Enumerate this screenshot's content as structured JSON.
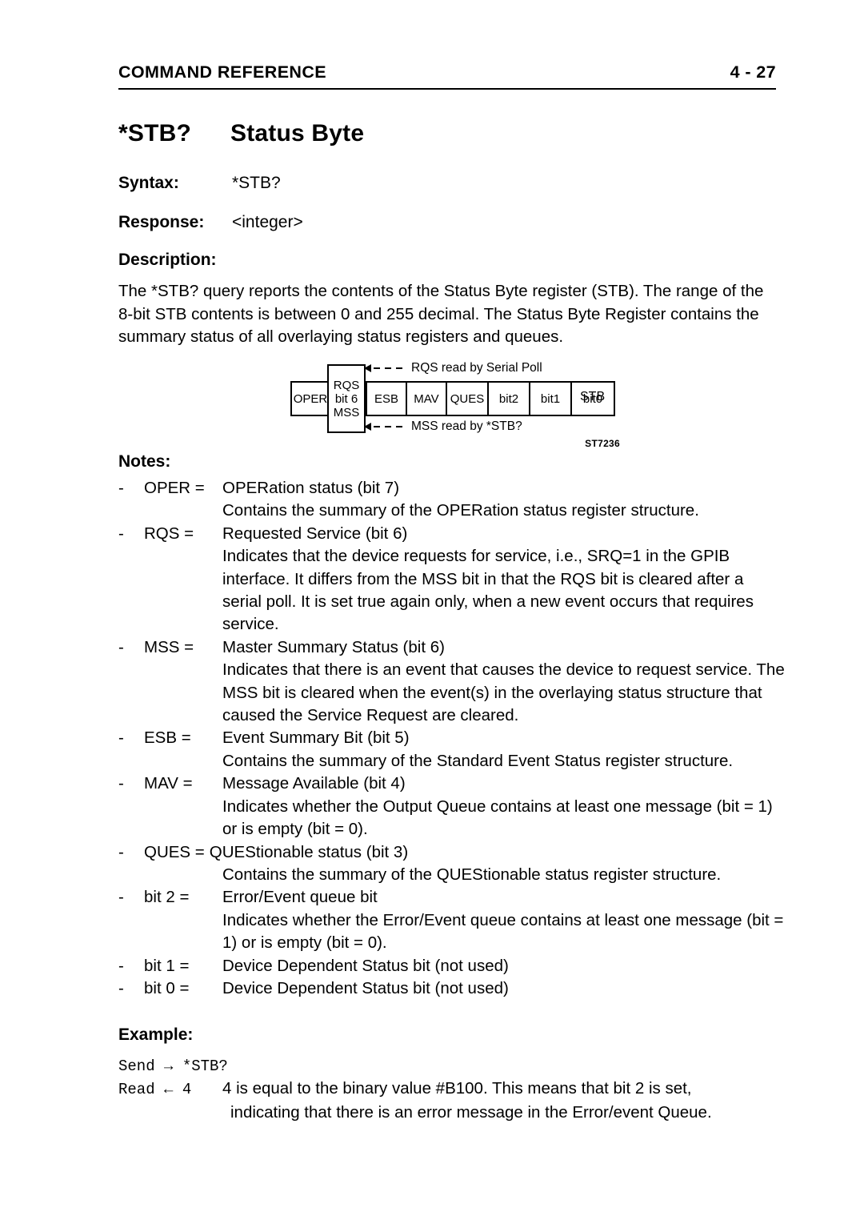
{
  "header": {
    "section": "COMMAND REFERENCE",
    "page_number": "4 - 27"
  },
  "title": {
    "command": "*STB?",
    "name": "Status Byte"
  },
  "fields": {
    "syntax_label": "Syntax:",
    "syntax_value": "*STB?",
    "response_label": "Response:",
    "response_value": "<integer>"
  },
  "description": {
    "heading": "Description:",
    "text": "The *STB? query reports the contents of the Status Byte register (STB). The range of the 8-bit STB contents is between 0 and 255 decimal. The Status Byte Register contains the summary status of all overlaying status registers and queues."
  },
  "diagram": {
    "cells": [
      {
        "label": "OPER"
      },
      {
        "label": ""
      },
      {
        "label": "ESB"
      },
      {
        "label": "MAV"
      },
      {
        "label": "QUES"
      },
      {
        "label": "bit2"
      },
      {
        "label": "bit1"
      },
      {
        "label": "bit0"
      }
    ],
    "overlay_box": {
      "line1": "RQS",
      "line2": "bit 6",
      "line3": "MSS"
    },
    "register_label": "STB",
    "annotation_top": "RQS read by Serial Poll",
    "annotation_bottom": "MSS read by *STB?",
    "figure_id": "ST7236"
  },
  "notes": {
    "heading": "Notes:",
    "bullet": "-",
    "items": [
      {
        "term": "OPER =",
        "definition": "OPERation status (bit 7)",
        "body": "Contains the summary of the OPERation status register structure."
      },
      {
        "term": "RQS =",
        "definition": "Requested Service (bit 6)",
        "body": "Indicates that the device requests for service, i.e., SRQ=1 in the GPIB interface. It differs from the MSS bit in that the RQS bit is cleared after a serial poll. It is set true again only, when a new event occurs that requires service."
      },
      {
        "term": "MSS =",
        "definition": "Master Summary Status (bit 6)",
        "body": "Indicates that there is an event that causes the device to request service. The MSS bit is cleared when the event(s) in the overlaying status structure that caused the Service Request are cleared."
      },
      {
        "term": "ESB =",
        "definition": "Event Summary Bit (bit 5)",
        "body": "Contains the summary of the Standard Event Status register structure."
      },
      {
        "term": "MAV =",
        "definition": "Message Available (bit 4)",
        "body": "Indicates whether the Output Queue contains at least one message (bit = 1) or is empty (bit = 0)."
      },
      {
        "term": "QUES =",
        "definition": "QUEStionable status (bit 3)",
        "body": "Contains the summary of the QUEStionable status register structure."
      },
      {
        "term": "bit 2 =",
        "definition": "Error/Event queue bit",
        "body": "Indicates whether the Error/Event queue contains at least one message (bit = 1) or is empty (bit = 0)."
      },
      {
        "term": "bit 1 =",
        "definition": "Device Dependent Status bit (not used)",
        "body": ""
      },
      {
        "term": "bit 0 =",
        "definition": "Device Dependent Status bit (not used)",
        "body": ""
      }
    ]
  },
  "example": {
    "heading": "Example:",
    "send_code": "Send → *STB?",
    "read_code": "Read ← 4",
    "read_text_line1": "4 is equal to the binary value #B100. This means that bit 2 is set,",
    "read_text_line2": "indicating that there is an error message in the Error/event Queue."
  }
}
